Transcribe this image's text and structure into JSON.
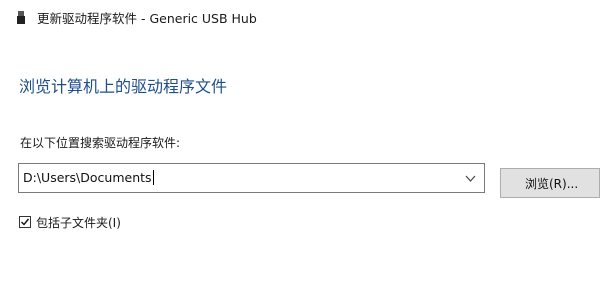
{
  "window": {
    "title": "更新驱动程序软件 - Generic USB Hub",
    "icon": "usb-device-icon"
  },
  "main": {
    "heading": "浏览计算机上的驱动程序文件",
    "search_label": "在以下位置搜索驱动程序软件:",
    "path_value": "D:\\Users\\Documents",
    "browse_label": "浏览(R)...",
    "include_subfolders_label": "包括子文件夹(I)",
    "include_subfolders_checked": true
  },
  "colors": {
    "heading": "#1f4e8c",
    "button_bg": "#e1e1e1"
  }
}
